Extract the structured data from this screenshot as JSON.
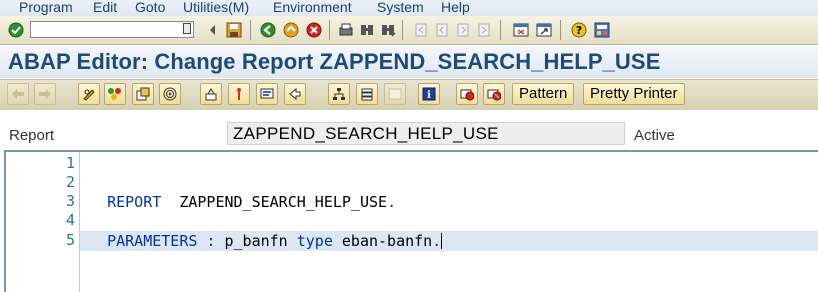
{
  "menubar": {
    "items": [
      "Program",
      "Edit",
      "Goto",
      "Utilities(M)",
      "Environment",
      "System",
      "Help"
    ]
  },
  "system_toolbar": {
    "command_field_value": "",
    "icons": [
      "enter-icon",
      "save-icon",
      "back-icon",
      "exit-icon",
      "cancel-icon",
      "print-icon",
      "find-icon",
      "find-next-icon",
      "first-page-icon",
      "previous-page-icon",
      "next-page-icon",
      "last-page-icon",
      "new-session-icon",
      "shortcut-icon",
      "help-icon",
      "layout-menu-icon"
    ]
  },
  "title": {
    "text": "ABAP Editor: Change Report ZAPPEND_SEARCH_HELP_USE"
  },
  "app_toolbar": {
    "pattern_label": "Pattern",
    "pretty_printer_label": "Pretty Printer"
  },
  "report": {
    "label": "Report",
    "name": "ZAPPEND_SEARCH_HELP_USE",
    "status": "Active"
  },
  "editor": {
    "line_numbers": [
      "1",
      "2",
      "3",
      "4",
      "5"
    ],
    "line3": {
      "keyword": "REPORT",
      "name": "ZAPPEND_SEARCH_HELP_USE",
      "terminator": "."
    },
    "line5": {
      "keyword": "PARAMETERS",
      "colon": ":",
      "param": "p_banfn",
      "type_kw": "type",
      "ref": "eban-banfn",
      "terminator": "."
    }
  },
  "colors": {
    "keyword": "#0033aa",
    "line_number": "#2a7a7a",
    "title": "#1e4a7a",
    "current_line": "#dde7f3"
  }
}
